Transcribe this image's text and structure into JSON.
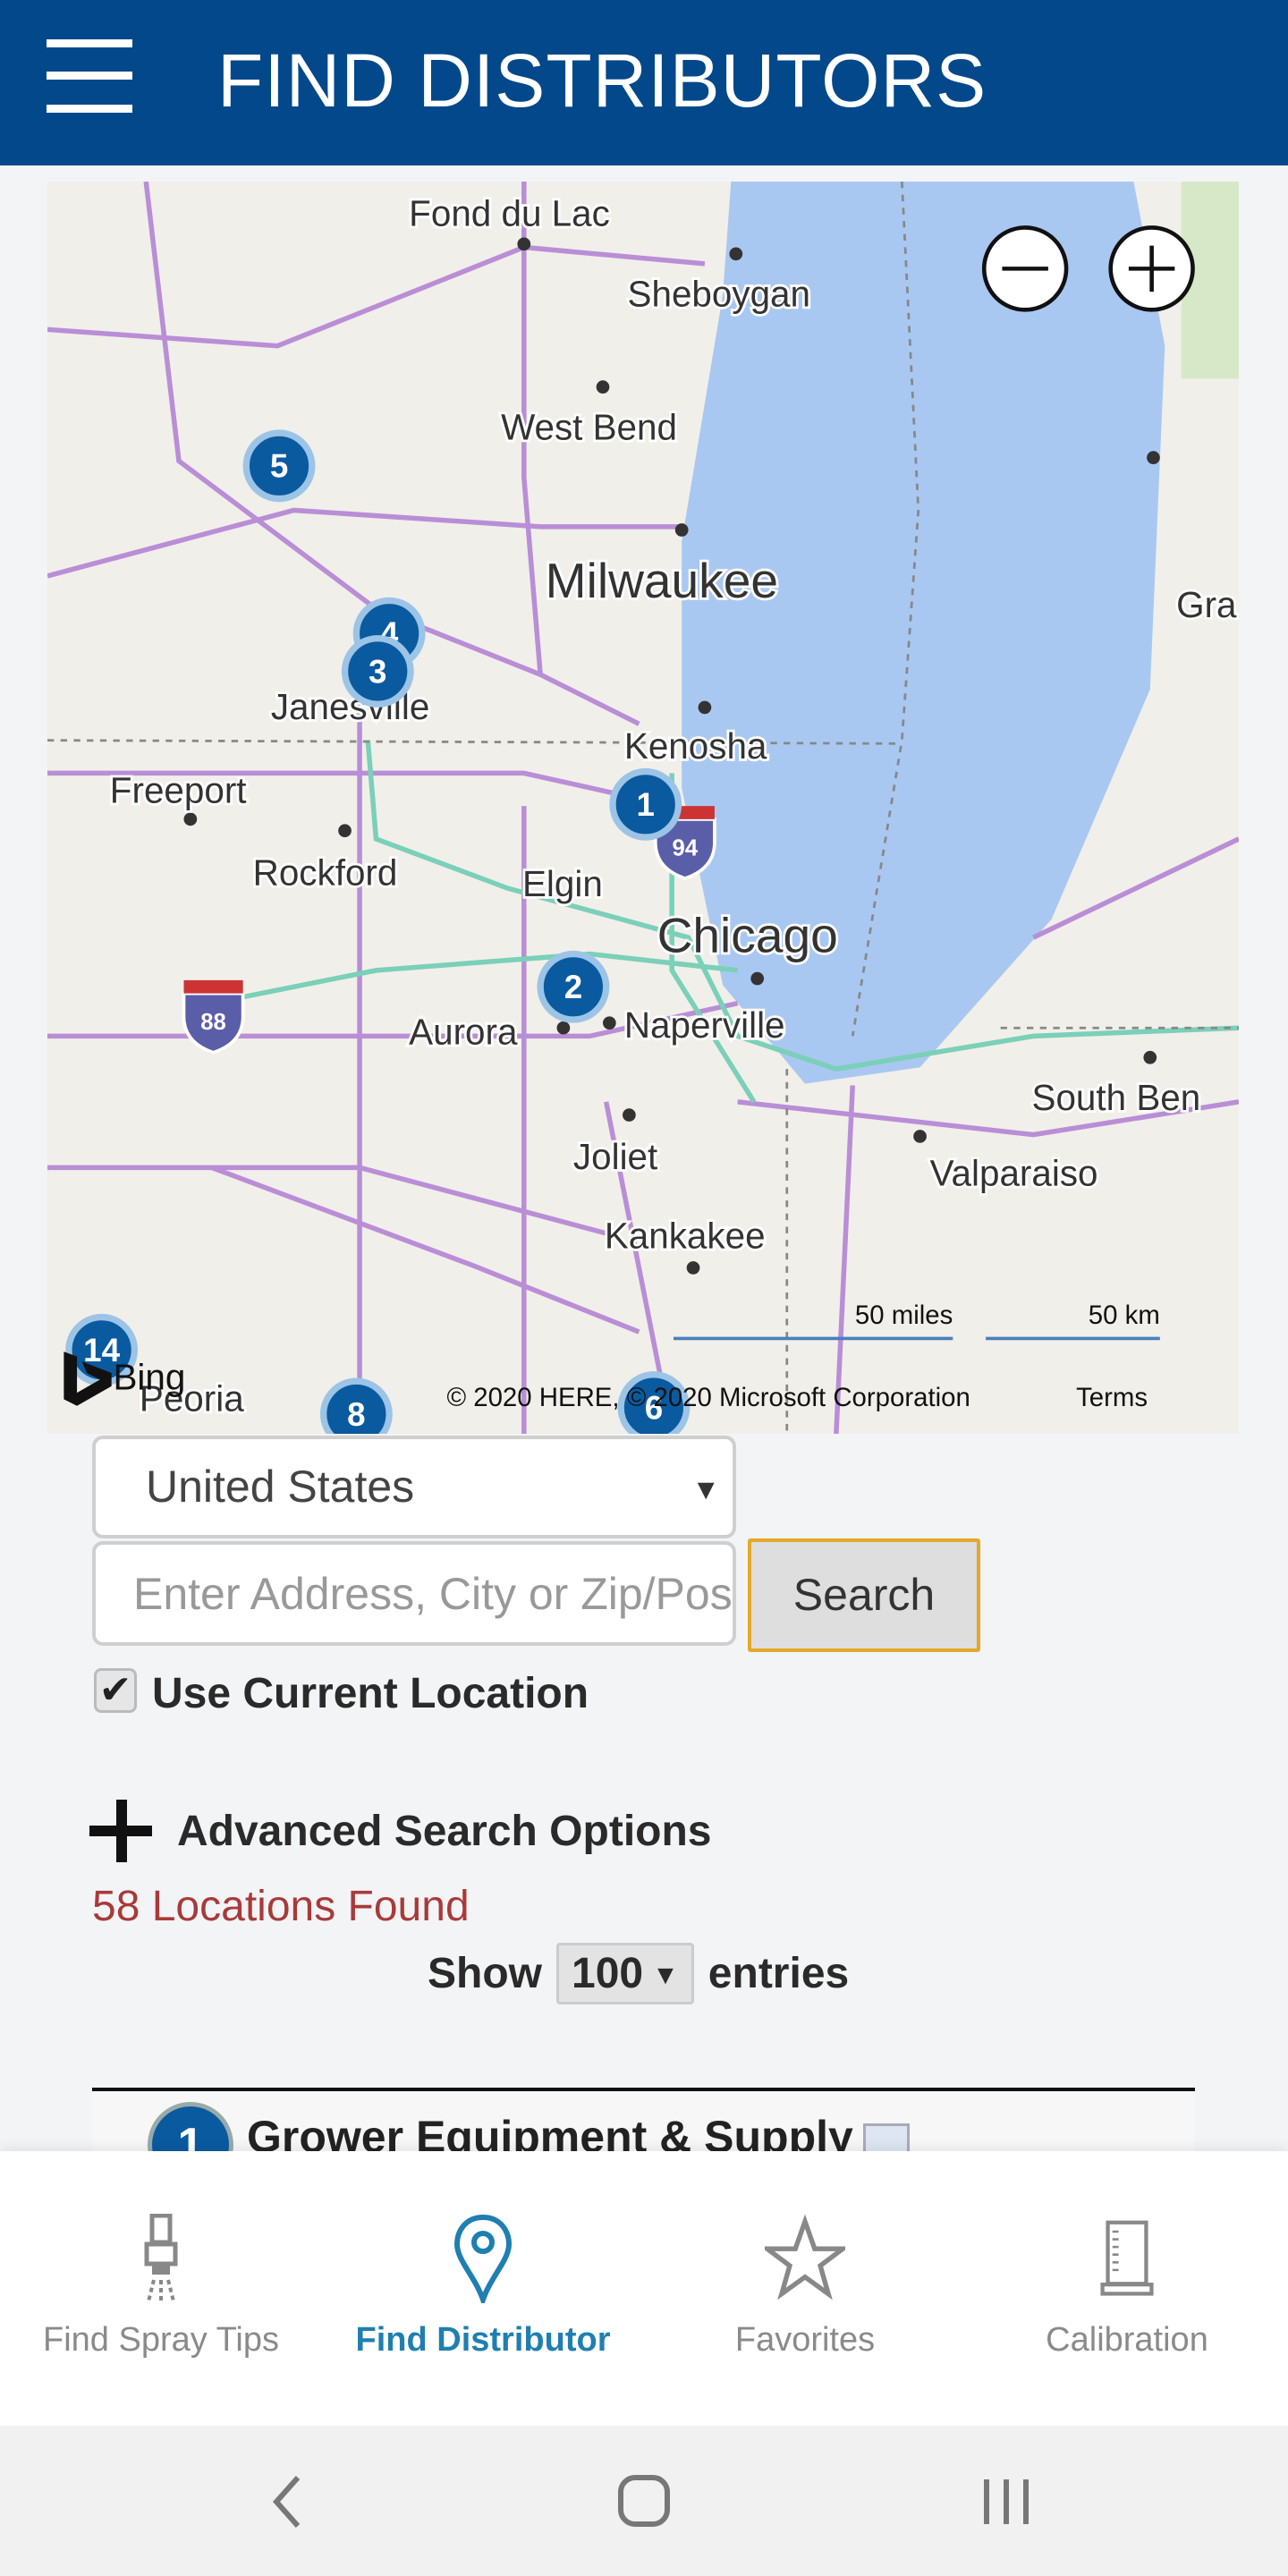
{
  "header": {
    "title": "FIND DISTRIBUTORS",
    "menu_icon": "hamburger-icon"
  },
  "map": {
    "cities": [
      "Fond du Lac",
      "Sheboygan",
      "West Bend",
      "Milwaukee",
      "Janesville",
      "Kenosha",
      "Freeport",
      "Rockford",
      "Elgin",
      "Chicago",
      "Aurora",
      "Naperville",
      "Joliet",
      "Kankakee",
      "Valparaiso",
      "South Ben",
      "Gra",
      "Peoria"
    ],
    "markers": [
      "5",
      "4",
      "3",
      "1",
      "2",
      "14",
      "8",
      "6"
    ],
    "shields": [
      "94",
      "88"
    ],
    "scale_miles": "50 miles",
    "scale_km": "50 km",
    "logo": "Bing",
    "attribution": "© 2020 HERE, © 2020 Microsoft Corporation",
    "terms": "Terms",
    "colors": {
      "land": "#f1efe9",
      "water": "#a9c8f1",
      "road": "#b98ed6",
      "highway": "#7ad0b8"
    }
  },
  "form": {
    "country": "United States",
    "address_placeholder": "Enter Address, City or Zip/Postal Code",
    "search_label": "Search",
    "use_current_location": "Use Current Location",
    "use_current_location_checked": true,
    "advanced": "Advanced Search Options"
  },
  "results": {
    "count_text": "58 Locations Found",
    "show_label": "Show",
    "entries_value": "100",
    "entries_label": "entries",
    "items": [
      {
        "number": "1",
        "name": "Grower Equipment & Supply"
      }
    ]
  },
  "bottom_nav": [
    {
      "label": "Find Spray Tips",
      "icon": "spray-nozzle-icon",
      "active": false
    },
    {
      "label": "Find Distributor",
      "icon": "map-pin-icon",
      "active": true
    },
    {
      "label": "Favorites",
      "icon": "star-icon",
      "active": false
    },
    {
      "label": "Calibration",
      "icon": "calibration-cylinder-icon",
      "active": false
    }
  ],
  "accent": "#1f7fb0",
  "brand": "#03488a"
}
